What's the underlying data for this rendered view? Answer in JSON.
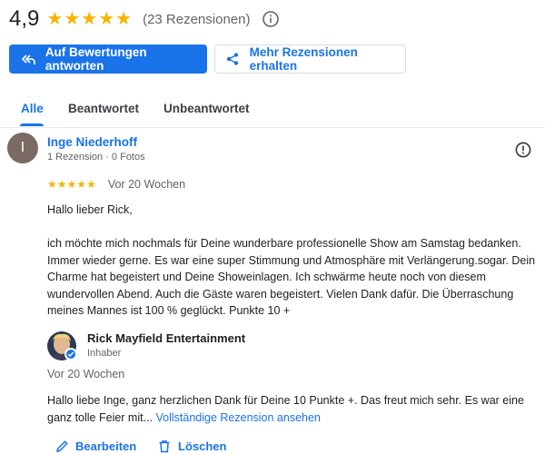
{
  "summary": {
    "rating": "4,9",
    "stars": 5,
    "review_count": "(23 Rezensionen)"
  },
  "buttons": {
    "reply": "Auf Bewertungen antworten",
    "more_reviews": "Mehr Rezensionen erhalten"
  },
  "tabs": [
    {
      "label": "Alle",
      "active": true
    },
    {
      "label": "Beantwortet",
      "active": false
    },
    {
      "label": "Unbeantwortet",
      "active": false
    }
  ],
  "review": {
    "avatar_letter": "I",
    "reviewer": "Inge Niederhoff",
    "meta": "1 Rezension · 0 Fotos",
    "stars": 5,
    "date": "Vor 20 Wochen",
    "text": "Hallo lieber Rick,\n\nich möchte mich nochmals für Deine wunderbare professionelle Show am Samstag bedanken. Immer wieder gerne. Es war eine super Stimmung und Atmosphäre mit Verlängerung.sogar. Dein Charme hat begeistert und Deine Showeinlagen. Ich schwärme heute noch von diesem wundervollen Abend. Auch die Gäste waren begeistert. Vielen Dank dafür. Die Überraschung meines Mannes ist 100 % geglückt. Punkte 10 +"
  },
  "reply": {
    "owner_name": "Rick Mayfield Entertainment",
    "owner_role": "Inhaber",
    "date": "Vor 20 Wochen",
    "text": "Hallo liebe Inge, ganz herzlichen Dank für Deine 10 Punkte +. Das freut mich sehr. Es war eine ganz tolle Feier mit...",
    "full_review_link": "Vollständige Rezension ansehen"
  },
  "actions": {
    "edit": "Bearbeiten",
    "delete": "Löschen"
  },
  "colors": {
    "accent": "#1a73e8",
    "star": "#f4b400"
  }
}
